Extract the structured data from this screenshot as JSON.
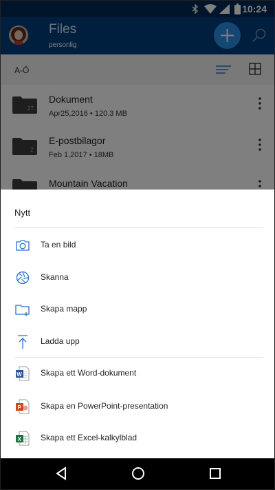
{
  "status_bar": {
    "time": "10:24"
  },
  "header": {
    "title": "Files",
    "subtitle": "personlig"
  },
  "sort_bar": {
    "label": "A-Ö"
  },
  "files": [
    {
      "name": "Dokument",
      "meta": "Apr25,2016 • 120.3 MB",
      "badge": "27"
    },
    {
      "name": "E-postbilagor",
      "meta": "Feb 1,2017 • 18MB",
      "badge": "2"
    },
    {
      "name": "Mountain Vacation",
      "meta": "",
      "badge": ""
    }
  ],
  "sheet": {
    "title": "Nytt",
    "items": [
      {
        "label": "Ta en bild",
        "icon": "camera-icon"
      },
      {
        "label": "Skanna",
        "icon": "aperture-icon"
      },
      {
        "label": "Skapa mapp",
        "icon": "folder-add-icon"
      },
      {
        "label": "Ladda upp",
        "icon": "upload-icon"
      },
      {
        "label": "Skapa ett Word-dokument",
        "icon": "word-icon"
      },
      {
        "label": "Skapa en PowerPoint-presentation",
        "icon": "powerpoint-icon"
      },
      {
        "label": "Skapa ett Excel-kalkylblad",
        "icon": "excel-icon"
      }
    ]
  },
  "colors": {
    "status_bar": "#002a57",
    "header": "#003f7d",
    "accent": "#2a8ee6",
    "word": "#2b579a",
    "powerpoint": "#d24726",
    "excel": "#217346"
  }
}
